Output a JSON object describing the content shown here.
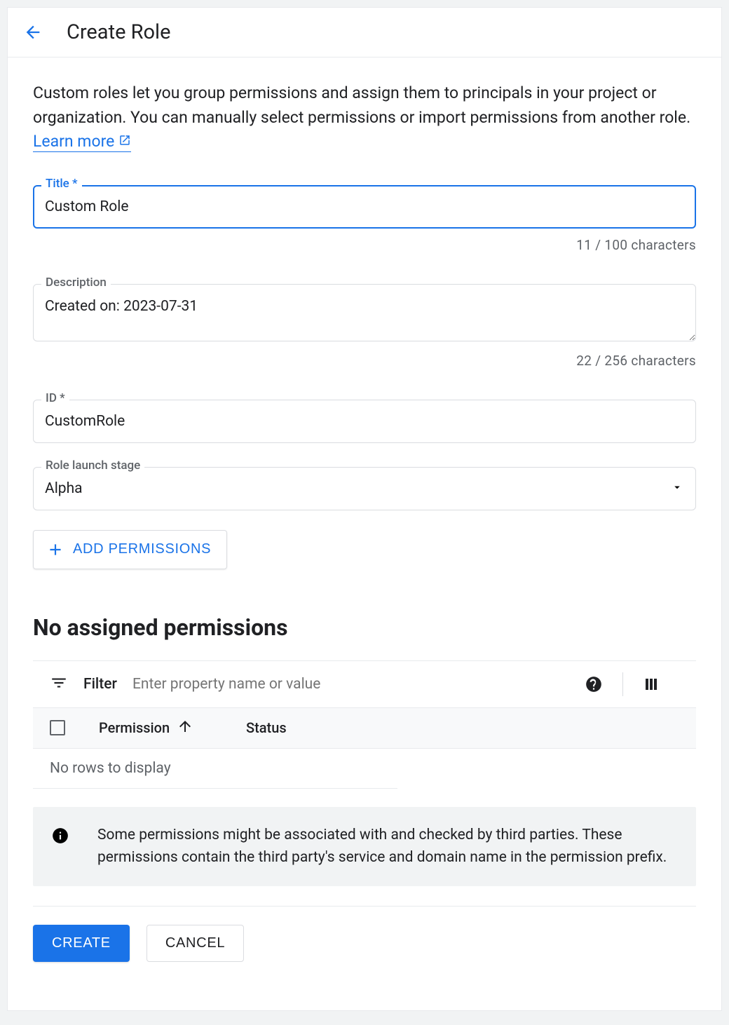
{
  "header": {
    "title": "Create Role"
  },
  "intro": {
    "text": "Custom roles let you group permissions and assign them to principals in your project or organization. You can manually select permissions or import permissions from another role. ",
    "learn_more": "Learn more"
  },
  "form": {
    "title": {
      "label": "Title *",
      "value": "Custom Role",
      "counter": "11 / 100 characters"
    },
    "description": {
      "label": "Description",
      "value": "Created on: 2023-07-31",
      "counter": "22 / 256 characters"
    },
    "id": {
      "label": "ID *",
      "value": "CustomRole"
    },
    "stage": {
      "label": "Role launch stage",
      "value": "Alpha"
    },
    "add_permissions_label": "ADD PERMISSIONS"
  },
  "permissions": {
    "heading": "No assigned permissions",
    "filter_label": "Filter",
    "filter_placeholder": "Enter property name or value",
    "columns": {
      "permission": "Permission",
      "status": "Status"
    },
    "empty": "No rows to display",
    "info": "Some permissions might be associated with and checked by third parties. These permissions contain the third party's service and domain name in the permission prefix."
  },
  "footer": {
    "create": "CREATE",
    "cancel": "CANCEL"
  }
}
